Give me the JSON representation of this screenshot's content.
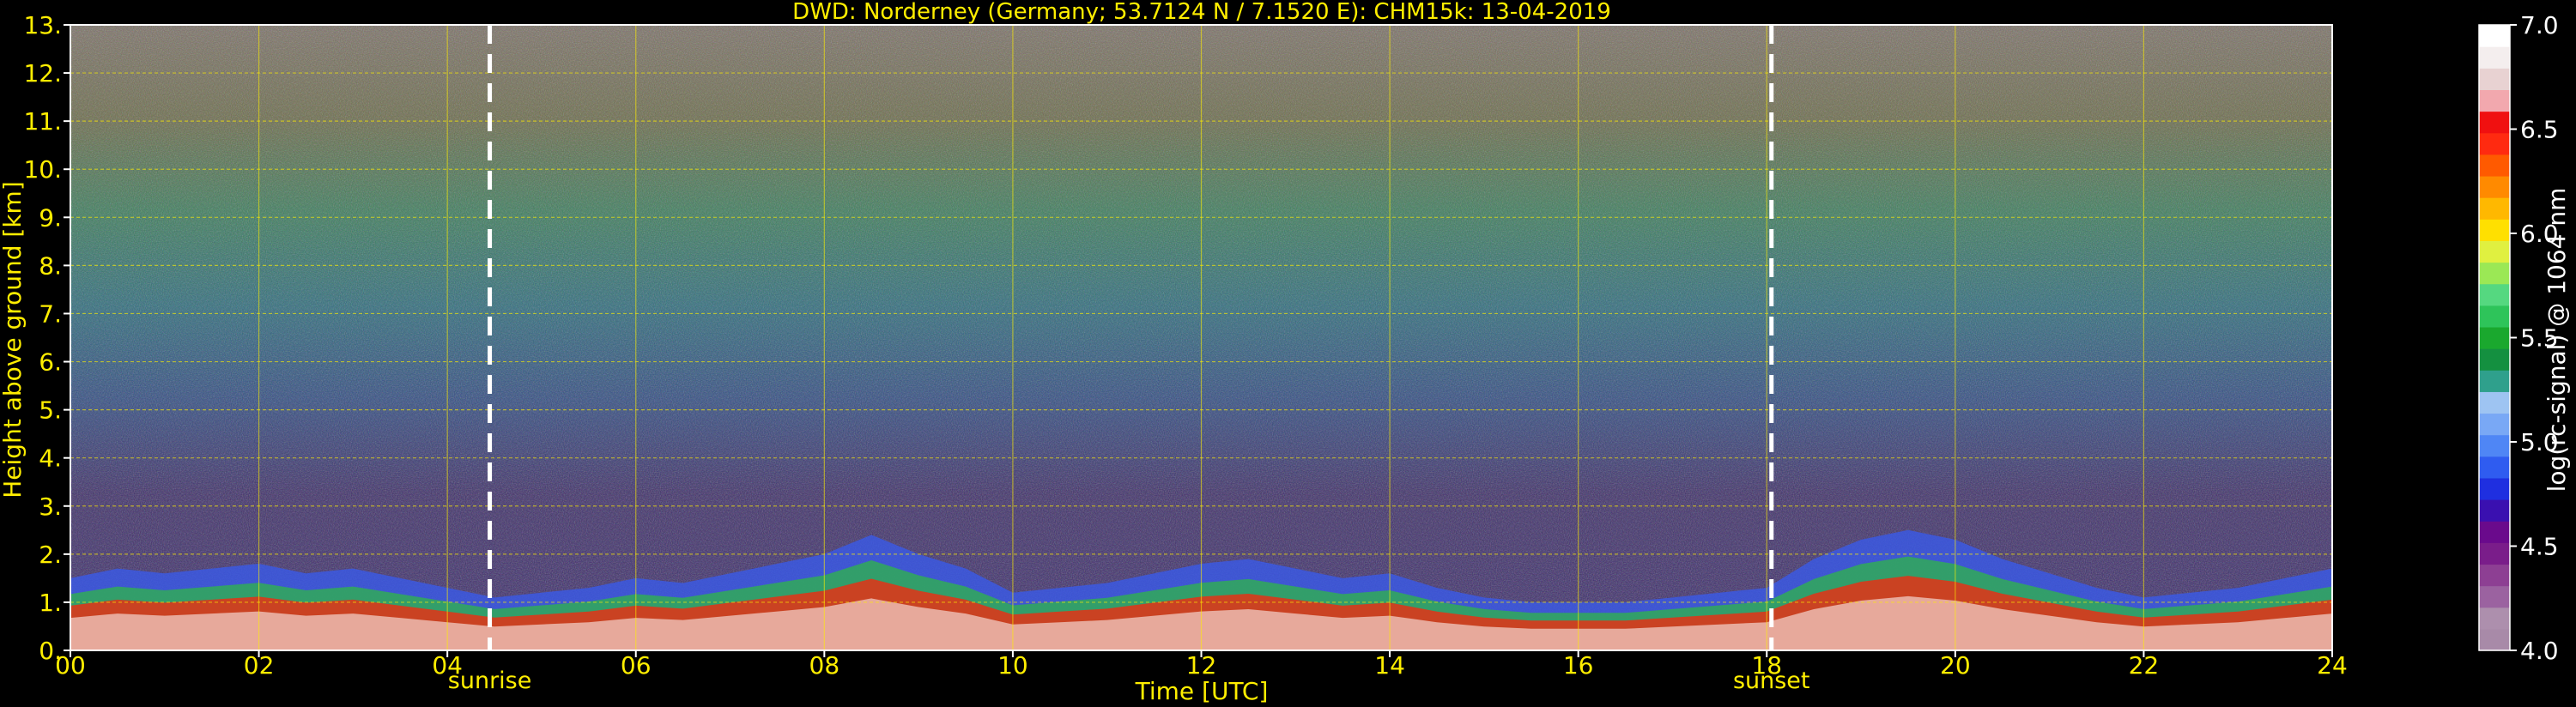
{
  "chart_data": {
    "type": "heatmap",
    "title": "DWD: Norderney (Germany; 53.7124 N / 7.1520 E):    CHM15k: 13-04-2019",
    "xlabel": "Time [UTC]",
    "ylabel": "Height above ground [km]",
    "xlim": [
      0,
      24
    ],
    "ylim": [
      0,
      13
    ],
    "x_ticks": [
      "00",
      "02",
      "04",
      "06",
      "08",
      "10",
      "12",
      "14",
      "16",
      "18",
      "20",
      "22",
      "24"
    ],
    "y_ticks": [
      "0.",
      "1.",
      "2.",
      "3.",
      "4.",
      "5.",
      "6.",
      "7.",
      "8.",
      "9.",
      "10.",
      "11.",
      "12.",
      "13."
    ],
    "grid": true,
    "annotations": [
      {
        "label": "sunrise",
        "x": 4.45
      },
      {
        "label": "sunset",
        "x": 18.05
      }
    ],
    "colorbar": {
      "label": "log(rc-signal) @ 1064 nm",
      "ticks": [
        "4.0",
        "4.5",
        "5.0",
        "5.5",
        "6.0",
        "6.5",
        "7.0"
      ],
      "range": [
        4.0,
        7.0
      ],
      "colors": [
        "#a88aa8",
        "#ad8fad",
        "#9b62a0",
        "#8d3f93",
        "#7a1d8a",
        "#6a0a8c",
        "#3a10b0",
        "#1f2fe0",
        "#2f5cf0",
        "#4f86f5",
        "#79a8f5",
        "#9ec4f2",
        "#2fa08c",
        "#149040",
        "#1aa82e",
        "#2ec45a",
        "#55d880",
        "#9be855",
        "#e0f040",
        "#ffe000",
        "#ffb800",
        "#ff8a00",
        "#ff5a00",
        "#ff2a10",
        "#f01010",
        "#f2a8ae",
        "#e8d2d2",
        "#f4eeee",
        "#ffffff"
      ]
    },
    "profile": {
      "times": [
        0,
        0.5,
        1,
        1.5,
        2,
        2.5,
        3,
        3.5,
        4,
        4.5,
        5,
        5.5,
        6,
        6.5,
        7,
        7.5,
        8,
        8.5,
        9,
        9.5,
        10,
        10.5,
        11,
        11.5,
        12,
        12.5,
        13,
        13.5,
        14,
        14.5,
        15,
        15.5,
        16,
        16.5,
        17,
        17.5,
        18,
        18.5,
        19,
        19.5,
        20,
        20.5,
        21,
        21.5,
        22,
        22.5,
        23,
        23.5,
        24
      ],
      "cloud_top_km": [
        1.5,
        1.7,
        1.6,
        1.7,
        1.8,
        1.6,
        1.7,
        1.5,
        1.3,
        1.1,
        1.2,
        1.3,
        1.5,
        1.4,
        1.6,
        1.8,
        2.0,
        2.4,
        2.0,
        1.7,
        1.2,
        1.3,
        1.4,
        1.6,
        1.8,
        1.9,
        1.7,
        1.5,
        1.6,
        1.3,
        1.1,
        1.0,
        1.0,
        1.0,
        1.1,
        1.2,
        1.3,
        1.9,
        2.3,
        2.5,
        2.3,
        1.9,
        1.6,
        1.3,
        1.1,
        1.2,
        1.3,
        1.5,
        1.7
      ]
    }
  }
}
